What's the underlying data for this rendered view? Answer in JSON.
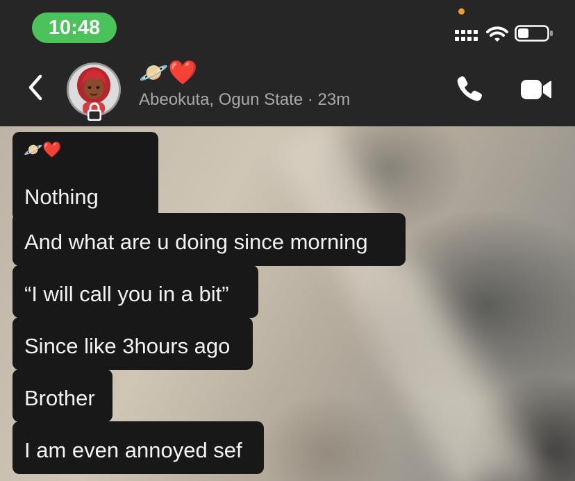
{
  "status_bar": {
    "time": "10:48",
    "time_pill_color": "#4cc25b",
    "privacy_dot_color": "#f09a36",
    "icons": [
      "signal-bars-icon",
      "wifi-icon",
      "battery-icon"
    ]
  },
  "header": {
    "back_icon": "chevron-left-icon",
    "avatar_icon": "bitmoji-avatar",
    "lock_icon": "lock-icon",
    "name": "🪐❤️",
    "subtitle": "Abeokuta, Ogun State · 23m",
    "call_icon": "phone-icon",
    "video_icon": "video-camera-icon"
  },
  "messages": [
    {
      "sender_label": "🪐❤️",
      "text": "Nothing"
    },
    {
      "text": "And what are u doing since morning"
    },
    {
      "text": "“I will call you in a bit”"
    },
    {
      "text": "Since like 3hours ago"
    },
    {
      "text": "Brother"
    },
    {
      "text": "I am even annoyed sef"
    }
  ],
  "colors": {
    "header_bg": "#262626",
    "bubble_bg": "#181818",
    "bubble_text": "#f2f2f2",
    "subtitle_text": "#a8a8a8"
  }
}
